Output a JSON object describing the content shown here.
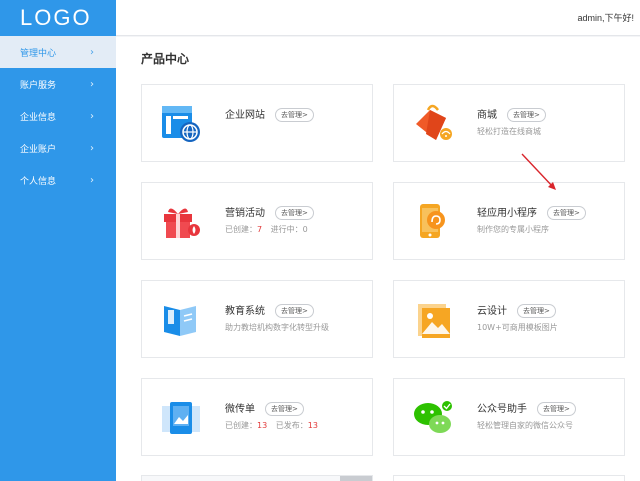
{
  "sidebar": {
    "logo": "LOGO",
    "items": [
      {
        "label": "管理中心",
        "active": true
      },
      {
        "label": "账户服务",
        "active": false
      },
      {
        "label": "企业信息",
        "active": false
      },
      {
        "label": "企业账户",
        "active": false
      },
      {
        "label": "个人信息",
        "active": false
      }
    ]
  },
  "header": {
    "greeting": "admin,下午好!"
  },
  "main": {
    "title": "产品中心",
    "cards": [
      {
        "title": "企业网站",
        "button": "去管理>",
        "desc": "",
        "icon": "website-icon"
      },
      {
        "title": "商城",
        "button": "去管理>",
        "desc": "轻松打造在线商城",
        "icon": "shopping-bag-icon"
      },
      {
        "title": "营销活动",
        "button": "去管理>",
        "desc_parts": {
          "created_label": "已创建：",
          "created_value": "7",
          "running_label": "进行中：",
          "running_value": "0"
        },
        "icon": "gift-icon"
      },
      {
        "title": "轻应用小程序",
        "button": "去管理>",
        "desc": "制作您的专属小程序",
        "icon": "mini-program-icon"
      },
      {
        "title": "教育系统",
        "button": "去管理>",
        "desc": "助力教培机构数字化转型升级",
        "icon": "book-icon"
      },
      {
        "title": "云设计",
        "button": "去管理>",
        "desc": "10W+可商用模板图片",
        "icon": "image-icon"
      },
      {
        "title": "微传单",
        "button": "去管理>",
        "desc_parts": {
          "created_label": "已创建：",
          "created_value": "13",
          "published_label": "已发布：",
          "published_value": "13"
        },
        "icon": "flyer-icon"
      },
      {
        "title": "公众号助手",
        "button": "去管理>",
        "desc": "轻松管理自家的微信公众号",
        "icon": "wechat-icon"
      }
    ]
  },
  "colors": {
    "sidebar_bg": "#2f97e9",
    "active_bg": "#e3ecf6",
    "highlight_num": "#e23a3a",
    "arrow": "#d9252c"
  }
}
